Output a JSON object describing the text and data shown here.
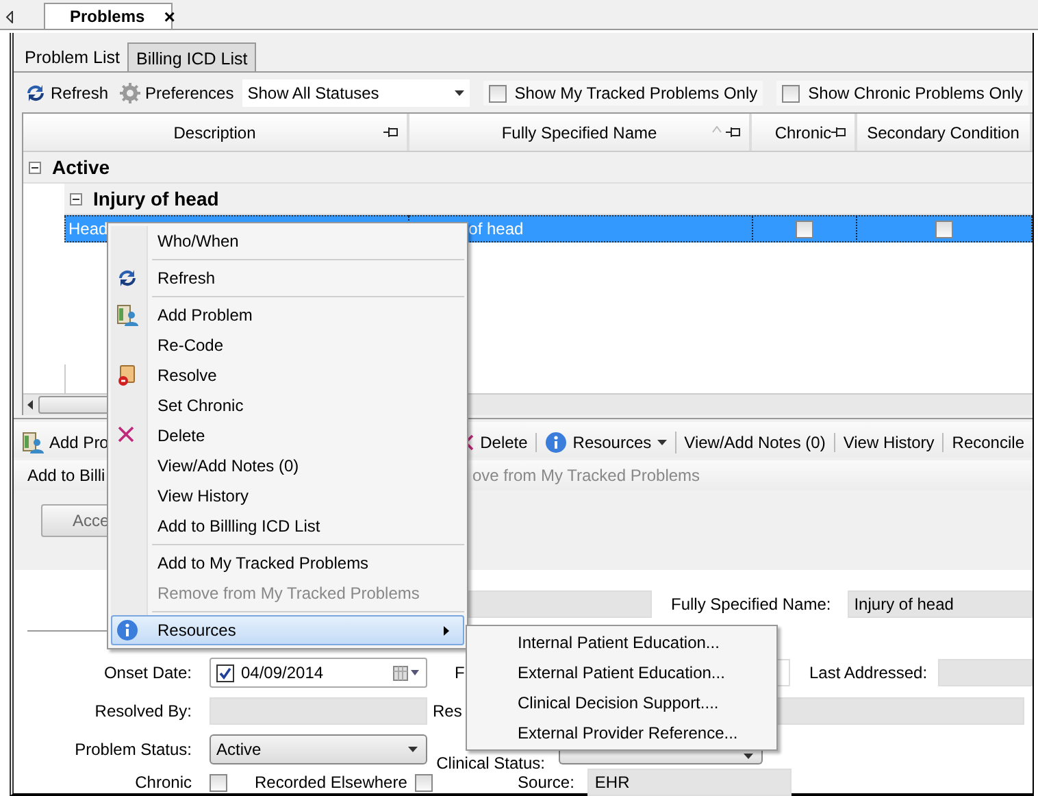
{
  "doc_tab": {
    "label": "Problems",
    "close": "×",
    "selected": true
  },
  "tabs": [
    {
      "label": "Problem List",
      "selected": true
    },
    {
      "label": "Billing ICD List",
      "selected": false
    }
  ],
  "toolbar": {
    "refresh": "Refresh",
    "preferences": "Preferences",
    "status_filter": "Show All Statuses",
    "filters": [
      {
        "label": "Show My Tracked Problems Only",
        "checked": false
      },
      {
        "label": "Show Chronic Problems Only",
        "checked": false
      }
    ]
  },
  "grid": {
    "columns": [
      "Description",
      "Fully Specified Name",
      "Chronic",
      "Secondary Condition"
    ],
    "groups": [
      {
        "label": "Active",
        "expanded": true,
        "children": [
          {
            "label": "Injury of head",
            "expanded": true,
            "rows": [
              {
                "description": "Head",
                "fully_specified_name": "of head",
                "chronic": false,
                "secondary_condition": false,
                "selected": true
              }
            ]
          }
        ]
      }
    ]
  },
  "actions": [
    {
      "label": "Add Pro",
      "kind": "add"
    },
    {
      "label": "Delete",
      "kind": "delete"
    },
    {
      "label": "Resources",
      "kind": "resources"
    },
    {
      "label": "View/Add Notes (0)",
      "kind": "plain"
    },
    {
      "label": "View History",
      "kind": "plain"
    },
    {
      "label": "Reconcile",
      "kind": "plain"
    }
  ],
  "actions_2": [
    {
      "label": "Add to Billi",
      "disabled": false
    },
    {
      "label": "ove from My Tracked Problems",
      "disabled": true
    }
  ],
  "accept_button": "Acce",
  "form": {
    "top_field": {
      "label": "Fully Specified Name:",
      "value": "Injury of head"
    },
    "onset": {
      "label": "Onset Date:",
      "checked": true,
      "value": "04/09/2014"
    },
    "resolved_by": {
      "label": "Resolved By:"
    },
    "problem_status": {
      "label": "Problem Status:",
      "value": "Active"
    },
    "chronic": {
      "label": "Chronic",
      "checked": false
    },
    "recorded_elsewhere": {
      "label": "Recorded Elsewhere",
      "checked": false
    },
    "column_2": [
      {
        "label": "F"
      },
      {
        "label": "Res"
      },
      {
        "label": "Clinical Status:"
      },
      {
        "label": "Source:",
        "value": "EHR"
      }
    ],
    "last_addressed": {
      "label": "Last Addressed:"
    }
  },
  "context_menu": {
    "groups": [
      [
        {
          "label": "Who/When",
          "disabled": false
        }
      ],
      [
        {
          "label": "Refresh",
          "disabled": false
        }
      ],
      [
        {
          "label": "Add Problem",
          "disabled": false
        },
        {
          "label": "Re-Code",
          "disabled": false
        },
        {
          "label": "Resolve",
          "disabled": false
        },
        {
          "label": "Set Chronic",
          "disabled": false
        },
        {
          "label": "Delete",
          "disabled": false
        },
        {
          "label": "View/Add Notes (0)",
          "disabled": false
        },
        {
          "label": "View History",
          "disabled": false
        },
        {
          "label": "Add to Billling ICD List",
          "disabled": false
        }
      ],
      [
        {
          "label": "Add to My Tracked Problems",
          "disabled": false
        },
        {
          "label": "Remove from My Tracked Problems",
          "disabled": true
        }
      ],
      [
        {
          "label": "Resources",
          "disabled": false,
          "highlighted": true,
          "submenu": [
            "Internal Patient Education...",
            "External Patient Education...",
            "Clinical Decision Support....",
            "External Provider Reference..."
          ]
        }
      ]
    ]
  }
}
